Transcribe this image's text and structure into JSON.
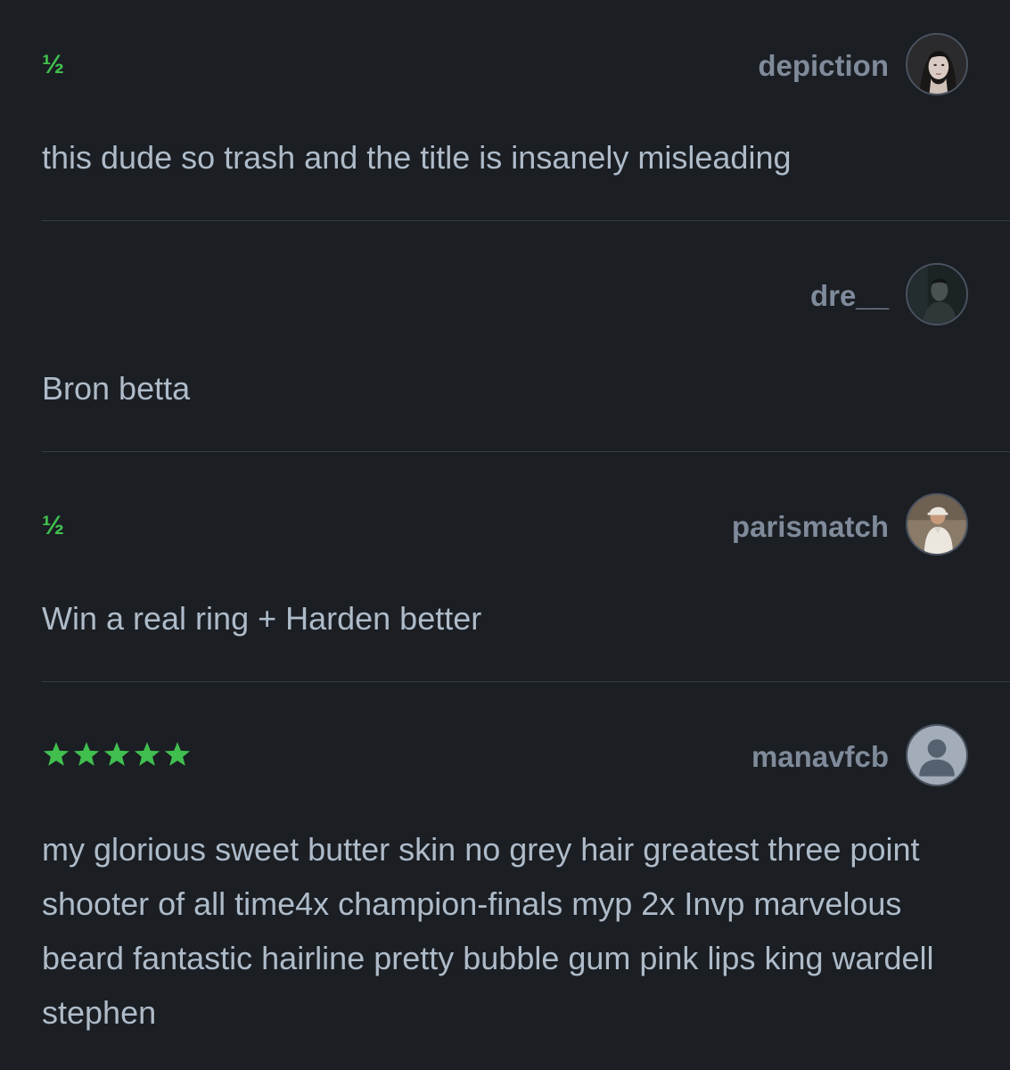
{
  "colors": {
    "background": "#1b1e23",
    "rating_green": "#40bf4f",
    "author": "#7f8b9a",
    "text": "#aebbc9",
    "divider": "#363c45"
  },
  "reviews": [
    {
      "rating": "½",
      "stars": 0,
      "author": "depiction",
      "avatar_icon": "user-photo",
      "text": "this dude so trash and the title is insanely misleading"
    },
    {
      "rating": "",
      "stars": 0,
      "author": "dre__",
      "avatar_icon": "user-photo",
      "text": "Bron betta"
    },
    {
      "rating": "½",
      "stars": 0,
      "author": "parismatch",
      "avatar_icon": "user-photo",
      "text": "Win a real ring + Harden better"
    },
    {
      "rating": "",
      "stars": 5,
      "author": "manavfcb",
      "avatar_icon": "default-user-icon",
      "text": "my glorious sweet butter skin no grey hair greatest three point shooter of all time4x champion-finals myp 2x Invp marvelous beard fantastic hairline pretty bubble gum pink lips king wardell stephen"
    }
  ]
}
